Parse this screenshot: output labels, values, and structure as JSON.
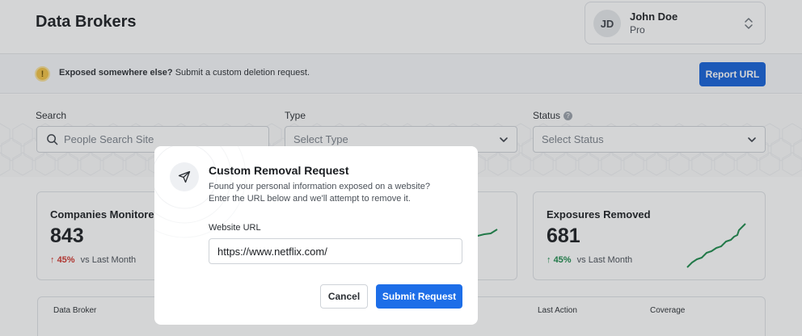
{
  "header": {
    "title": "Data Brokers",
    "user": {
      "initials": "JD",
      "name": "John Doe",
      "plan": "Pro"
    }
  },
  "banner": {
    "bold_text": "Exposed somewhere else?",
    "text": "Submit a custom deletion request.",
    "button_label": "Report URL",
    "icon": "warning-icon"
  },
  "filters": {
    "search": {
      "label": "Search",
      "placeholder": "People Search Site"
    },
    "type": {
      "label": "Type",
      "placeholder": "Select Type"
    },
    "status": {
      "label": "Status",
      "help": "?",
      "placeholder": "Select Status"
    }
  },
  "stats": [
    {
      "title": "Companies Monitored",
      "value": "843",
      "delta": "45%",
      "direction": "up",
      "delta_color": "#d0342c",
      "vs": "vs Last Month"
    },
    {
      "title": "",
      "value": "",
      "delta": "",
      "direction": "up",
      "delta_color": "#1b8a4b",
      "vs": ""
    },
    {
      "title": "Exposures Removed",
      "value": "681",
      "delta": "45%",
      "direction": "up",
      "delta_color": "#1b8a4b",
      "vs": "vs Last Month"
    }
  ],
  "table": {
    "columns": [
      "Data Broker",
      "Last Action",
      "Coverage"
    ]
  },
  "modal": {
    "title": "Custom Removal Request",
    "description_line1": "Found your personal information exposed on a website?",
    "description_line2": "Enter the URL below and we'll attempt to remove it.",
    "url_label": "Website URL",
    "url_value": "https://www.netflix.com/",
    "cancel_label": "Cancel",
    "submit_label": "Submit Request",
    "icon": "send-icon"
  },
  "colors": {
    "accent": "#1d6ee8",
    "report_button": "#1460d9",
    "positive": "#1b8a4b",
    "negative": "#d0342c",
    "sparkline": "#1b8a4b"
  }
}
